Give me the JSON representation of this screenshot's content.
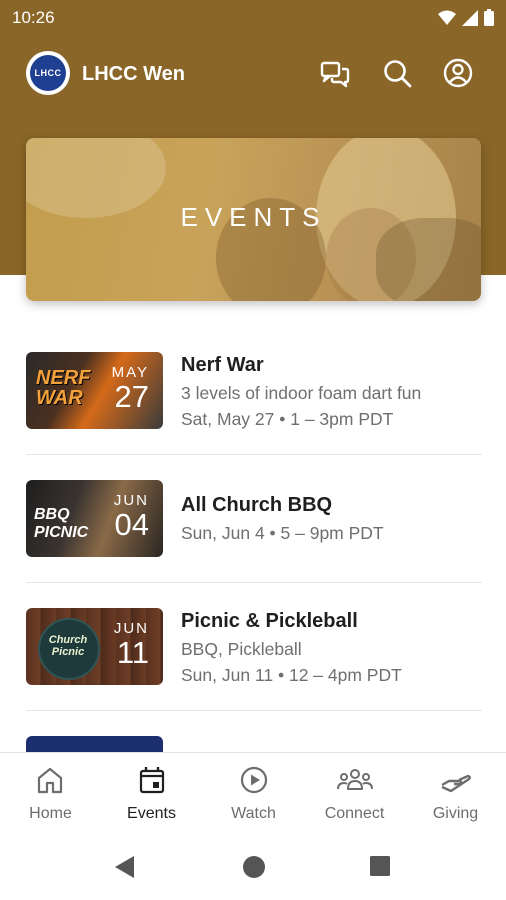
{
  "status": {
    "time": "10:26"
  },
  "app": {
    "name": "LHCC Wen",
    "logo_text": "LHCC"
  },
  "hero": {
    "title": "EVENTS"
  },
  "events": [
    {
      "title": "Nerf War",
      "description": "3 levels of indoor foam dart fun",
      "datetime": "Sat, May 27 • 1 – 3pm PDT",
      "month": "MAY",
      "day": "27",
      "thumb_art": "NERF WAR"
    },
    {
      "title": "All Church BBQ",
      "description": "",
      "datetime": "Sun, Jun 4 • 5 – 9pm PDT",
      "month": "JUN",
      "day": "04",
      "thumb_art": "BBQ PICNIC"
    },
    {
      "title": "Picnic & Pickleball",
      "description": "BBQ, Pickleball",
      "datetime": "Sun, Jun 11 • 12 – 4pm PDT",
      "month": "JUN",
      "day": "11",
      "thumb_art": "Church Picnic"
    }
  ],
  "nav": {
    "items": [
      {
        "label": "Home",
        "icon": "home-icon"
      },
      {
        "label": "Events",
        "icon": "calendar-icon"
      },
      {
        "label": "Watch",
        "icon": "play-icon"
      },
      {
        "label": "Connect",
        "icon": "people-icon"
      },
      {
        "label": "Giving",
        "icon": "giving-hand-icon"
      }
    ],
    "active": "Events"
  },
  "colors": {
    "brand": "#8a6628",
    "logo_blue": "#1f3f93"
  }
}
